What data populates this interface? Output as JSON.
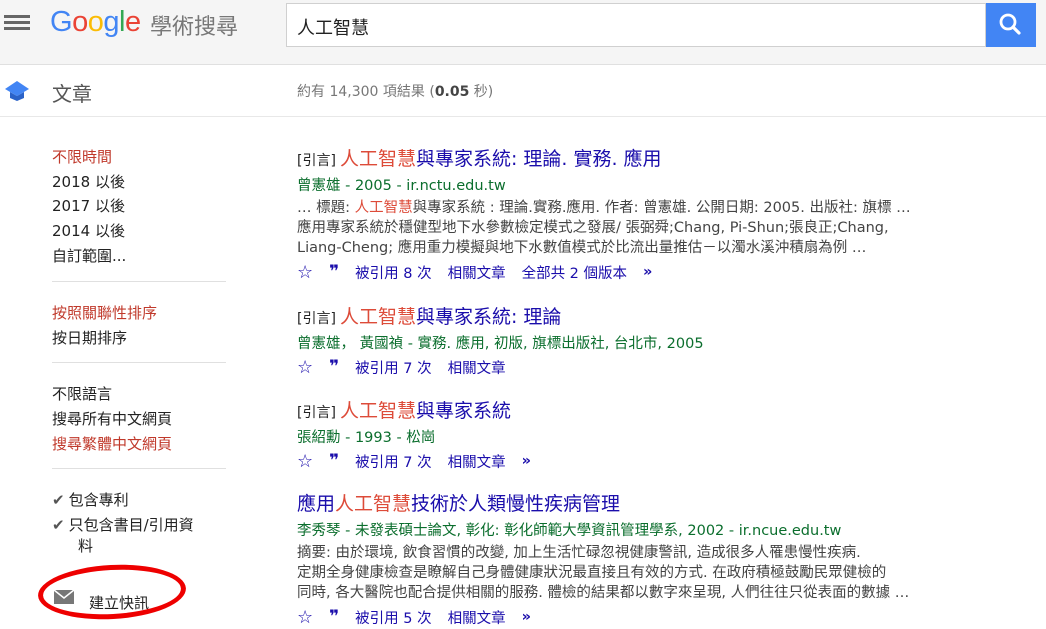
{
  "header": {
    "logo_letters": [
      "G",
      "o",
      "o",
      "g",
      "l",
      "e"
    ],
    "scholar_label": "學術搜尋",
    "search_value": "人工智慧",
    "menu_icon": "hamburger-icon",
    "search_icon": "search-icon",
    "colors": {
      "blue": "#4285f4",
      "red": "#ea4335",
      "yellow": "#fbbc05",
      "green": "#34a853"
    }
  },
  "subheader": {
    "section_label": "文章",
    "stats_prefix": "約有 14,300 項結果 (",
    "stats_time": "0.05",
    "stats_suffix": " 秒)"
  },
  "sidebar": {
    "time_filters": [
      "不限時間",
      "2018 以後",
      "2017 以後",
      "2014 以後",
      "自訂範圍..."
    ],
    "sort": [
      "按照關聯性排序",
      "按日期排序"
    ],
    "language": [
      "不限語言",
      "搜尋所有中文網頁",
      "搜尋繁體中文網頁"
    ],
    "include_patents": "包含專利",
    "include_citations": "只包含書目/引用資",
    "include_citations_2": "料",
    "create_alert": "建立快訊"
  },
  "results": [
    {
      "tag": "[引言]",
      "title_hl": "人工智慧",
      "title_rest": "與專家系統: 理論. 實務. 應用",
      "meta": "曾憲雄 - 2005 - ir.nctu.edu.tw",
      "snippet_1a": "… 標題: ",
      "snippet_1hl": "人工智慧",
      "snippet_1b": "與專家系統 : 理論.實務.應用. 作者: 曾憲雄. 公開日期: 2005. 出版社: 旗標 …",
      "snippet_2": "應用專家系統於穩健型地下水參數檢定模式之發展/ 張弼舜;Chang, Pi-Shun;張良正;Chang,",
      "snippet_3": "Liang-Cheng; 應用重力模擬與地下水數值模式於比流出量推估－以濁水溪沖積扇為例 …",
      "cited_by": "被引用 8 次",
      "related": "相關文章",
      "versions": "全部共 2 個版本"
    },
    {
      "tag": "[引言]",
      "title_hl": "人工智慧",
      "title_rest": "與專家系統: 理論",
      "meta": "曾憲雄， 黃國禎 - 實務. 應用, 初版, 旗標出版社, 台北市, 2005",
      "cited_by": "被引用 7 次",
      "related": "相關文章"
    },
    {
      "tag": "[引言]",
      "title_hl": "人工智慧",
      "title_rest": "與專家系統",
      "meta": "張紹勳 - 1993 - 松崗",
      "cited_by": "被引用 7 次",
      "related": "相關文章"
    },
    {
      "title_pre": "應用",
      "title_hl": "人工智慧",
      "title_rest": "技術於人類慢性疾病管理",
      "meta": "李秀琴 - 未發表碩士論文, 彰化: 彰化師範大學資訊管理學系, 2002 - ir.ncue.edu.tw",
      "snippet_1": "摘要: 由於環境, 飲食習慣的改變, 加上生活忙碌忽視健康警訊, 造成很多人罹患慢性疾病.",
      "snippet_2": "定期全身健康檢查是瞭解自己身體健康狀況最直接且有效的方式. 在政府積極鼓勵民眾健檢的",
      "snippet_3": "同時, 各大醫院也配合提供相關的服務. 體檢的結果都以數字來呈現, 人們往往只從表面的數據 …",
      "cited_by": "被引用 5 次",
      "related": "相關文章"
    }
  ],
  "icons": {
    "save": "star-icon",
    "cite": "quote-icon",
    "more": "double-chevron-icon",
    "alert": "mail-icon",
    "check": "checkmark-icon"
  }
}
